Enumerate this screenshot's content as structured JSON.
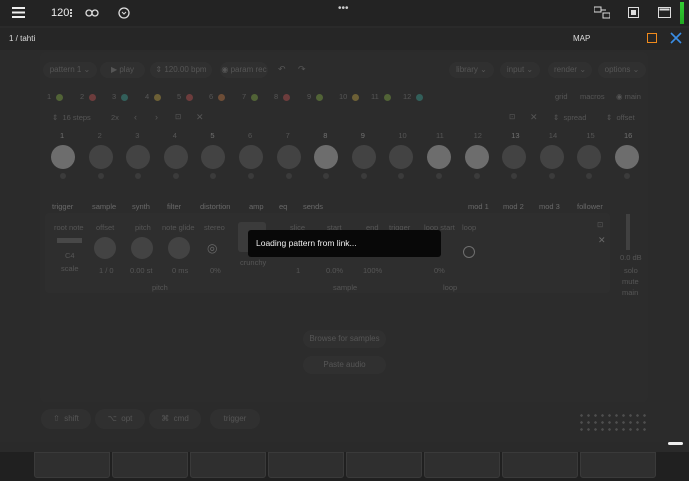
{
  "topbar": {
    "tempo": "120",
    "menu_icon": "hamburger-icon",
    "loop_icon": "loop-icon",
    "clock_icon": "timer-icon"
  },
  "plugin": {
    "path": "1 / tahti",
    "map": "MAP",
    "record_color": "#f08a1c",
    "close_color": "#3a8ee6"
  },
  "transport": {
    "pattern": "pattern 1",
    "play": "play",
    "tempo": "120.00 bpm",
    "param_rec": "param rec"
  },
  "right_menus": [
    "library",
    "input",
    "render",
    "options"
  ],
  "tracks": [
    {
      "label": "1",
      "color": "#8fbf4a"
    },
    {
      "label": "2",
      "color": "#d85a5a"
    },
    {
      "label": "3",
      "color": "#3fb3a6"
    },
    {
      "label": "4",
      "color": "#d8b84a"
    },
    {
      "label": "5",
      "color": "#d85a5a"
    },
    {
      "label": "6",
      "color": "#d8844a"
    },
    {
      "label": "7",
      "color": "#8fbf4a"
    },
    {
      "label": "8",
      "color": "#d85a5a"
    },
    {
      "label": "9",
      "color": "#8fbf4a"
    },
    {
      "label": "10",
      "color": "#d8b84a"
    },
    {
      "label": "11",
      "color": "#8fbf4a"
    },
    {
      "label": "12",
      "color": "#3fb3a6"
    }
  ],
  "view": {
    "grid": "grid",
    "macros": "macros",
    "main": "main"
  },
  "steps": {
    "count_label": "16 steps",
    "rate": "2x",
    "spread": "spread",
    "offset": "offset",
    "numbers": [
      "1",
      "2",
      "3",
      "4",
      "5",
      "6",
      "7",
      "8",
      "9",
      "10",
      "11",
      "12",
      "13",
      "14",
      "15",
      "16"
    ],
    "active": [
      true,
      false,
      false,
      false,
      false,
      false,
      false,
      true,
      false,
      false,
      true,
      true,
      false,
      false,
      false,
      true
    ]
  },
  "tabs": [
    "trigger",
    "sample",
    "synth",
    "filter",
    "distortion",
    "amp",
    "eq",
    "sends"
  ],
  "mod_tabs": [
    "mod 1",
    "mod 2",
    "mod 3",
    "follower"
  ],
  "params": {
    "root_note": "root note",
    "root_value": "C4",
    "scale": "scale",
    "offset": "offset",
    "offset_value": "1 / 0",
    "pitch": "pitch",
    "pitch_value": "0.00 st",
    "note_glide": "note glide",
    "glide_value": "0 ms",
    "stereo": "stereo",
    "stereo_value": "0%",
    "crunchy": "crunchy",
    "slice": "slice",
    "slice_value": "1",
    "start": "start",
    "start_value": "0.0%",
    "end": "end",
    "end_value": "100%",
    "trigger": "trigger",
    "loop_start": "loop start",
    "loop_start_value": "0%",
    "loop": "loop",
    "volume": "0.0 dB",
    "solo": "solo",
    "mute": "mute",
    "main_out": "main",
    "group1": "pitch",
    "group2": "sample",
    "group3": "loop"
  },
  "center": {
    "browse": "Browse for samples",
    "paste": "Paste audio"
  },
  "bottom": {
    "shift": "shift",
    "opt": "opt",
    "cmd": "cmd",
    "trigger": "trigger"
  },
  "overlay": {
    "message": "Loading pattern from link..."
  }
}
